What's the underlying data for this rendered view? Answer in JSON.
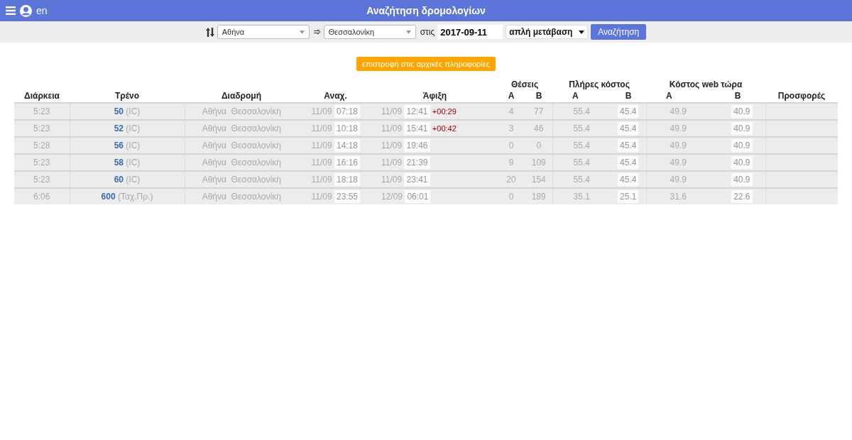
{
  "header": {
    "language": "en",
    "title": "Αναζήτηση δρομολογίων"
  },
  "search": {
    "from": "Αθήνα",
    "to": "Θεσσαλονίκη",
    "date_label": "στις",
    "date": "2017-09-11",
    "trip_type": "απλή μετάβαση",
    "button": "Αναζήτηση"
  },
  "back_button": "επιστροφή στις αρχικές πληροφορίες",
  "columns": {
    "duration": "Διάρκεια",
    "train": "Τρένο",
    "route": "Διαδρομή",
    "departure": "Αναχ.",
    "arrival": "Άφιξη",
    "seats": "Θέσεις",
    "full_cost": "Πλήρες κόστος",
    "web_cost": "Κόστος web τώρα",
    "seats_a": "Α",
    "seats_b": "Β",
    "full_a": "Α",
    "full_b": "Β",
    "web_a": "Α",
    "web_b": "Β",
    "offers": "Προσφορές"
  },
  "rows": [
    {
      "duration": "5:23",
      "number": "50",
      "type": "(IC)",
      "from": "Αθήνα",
      "to": "Θεσσαλονίκη",
      "dep_date": "11/09",
      "dep_time": "07:18",
      "arr_date": "11/09",
      "arr_time": "12:41",
      "delay": "+00:29",
      "seats_a": "4",
      "seats_b": "77",
      "full_a": "55.4",
      "full_b": "45.4",
      "web_a": "49.9",
      "web_b": "40.9"
    },
    {
      "duration": "5:23",
      "number": "52",
      "type": "(IC)",
      "from": "Αθήνα",
      "to": "Θεσσαλονίκη",
      "dep_date": "11/09",
      "dep_time": "10:18",
      "arr_date": "11/09",
      "arr_time": "15:41",
      "delay": "+00:42",
      "seats_a": "3",
      "seats_b": "46",
      "full_a": "55.4",
      "full_b": "45.4",
      "web_a": "49.9",
      "web_b": "40.9"
    },
    {
      "duration": "5:28",
      "number": "56",
      "type": "(IC)",
      "from": "Αθήνα",
      "to": "Θεσσαλονίκη",
      "dep_date": "11/09",
      "dep_time": "14:18",
      "arr_date": "11/09",
      "arr_time": "19:46",
      "seats_a": "0",
      "seats_b": "0",
      "full_a": "55.4",
      "full_b": "45.4",
      "web_a": "49.9",
      "web_b": "40.9"
    },
    {
      "duration": "5:23",
      "number": "58",
      "type": "(IC)",
      "from": "Αθήνα",
      "to": "Θεσσαλονίκη",
      "dep_date": "11/09",
      "dep_time": "16:16",
      "arr_date": "11/09",
      "arr_time": "21:39",
      "seats_a": "9",
      "seats_b": "109",
      "full_a": "55.4",
      "full_b": "45.4",
      "web_a": "49.9",
      "web_b": "40.9"
    },
    {
      "duration": "5:23",
      "number": "60",
      "type": "(IC)",
      "from": "Αθήνα",
      "to": "Θεσσαλονίκη",
      "dep_date": "11/09",
      "dep_time": "18:18",
      "arr_date": "11/09",
      "arr_time": "23:41",
      "seats_a": "20",
      "seats_b": "154",
      "full_a": "55.4",
      "full_b": "45.4",
      "web_a": "49.9",
      "web_b": "40.9"
    },
    {
      "duration": "6:06",
      "number": "600",
      "type": "(Ταχ.Πρ.)",
      "from": "Αθήνα",
      "to": "Θεσσαλονίκη",
      "dep_date": "11/09",
      "dep_time": "23:55",
      "arr_date": "12/09",
      "arr_time": "06:01",
      "seats_a": "0",
      "seats_b": "189",
      "full_a": "35.1",
      "full_b": "25.1",
      "web_a": "31.6",
      "web_b": "22.6"
    }
  ]
}
